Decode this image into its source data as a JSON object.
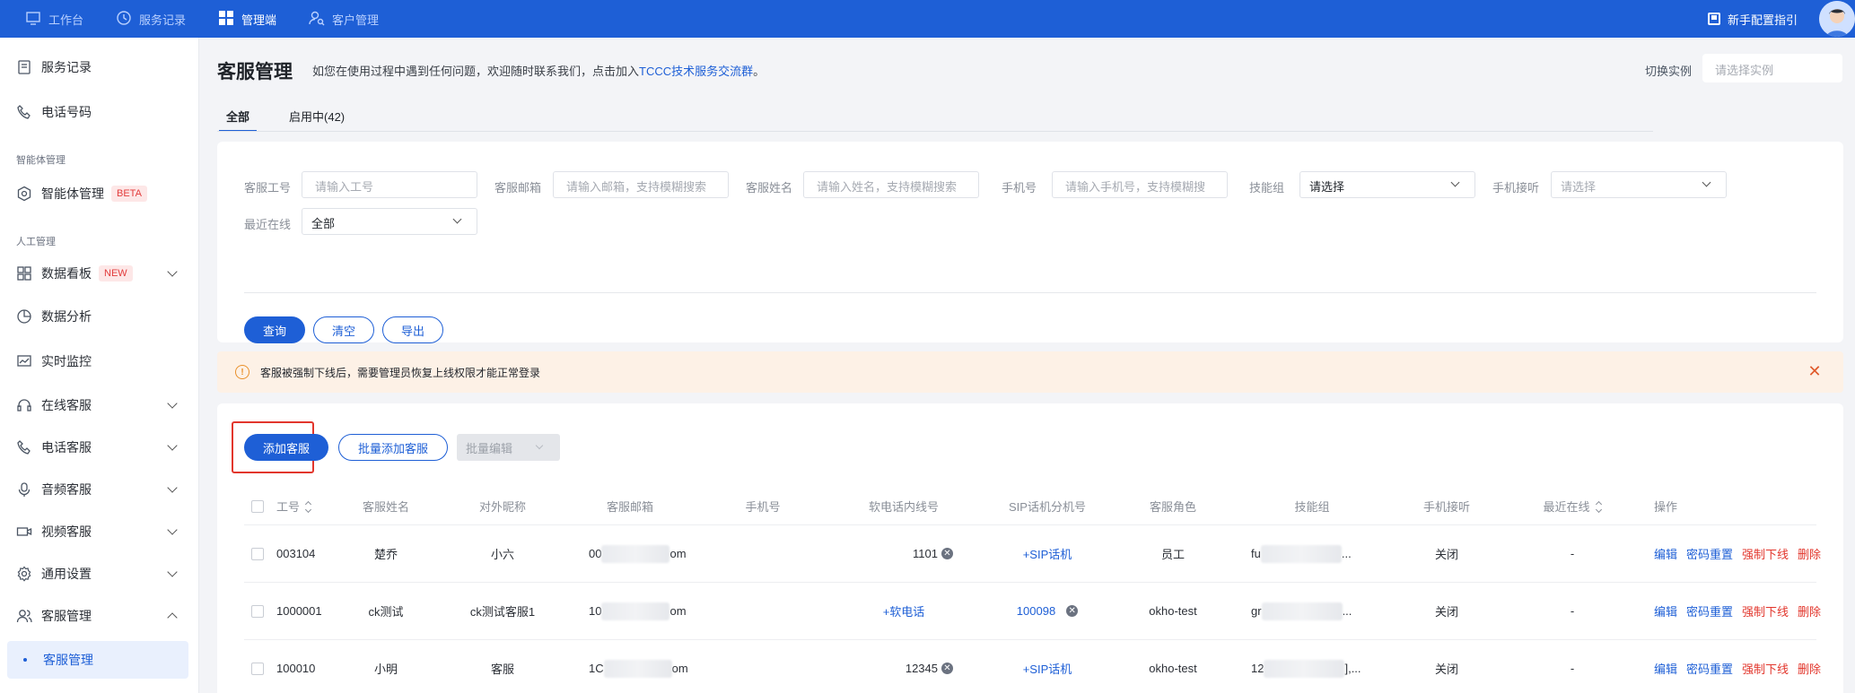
{
  "topbar": {
    "items": [
      {
        "label": "工作台",
        "icon": "monitor-icon"
      },
      {
        "label": "服务记录",
        "icon": "clock-icon"
      },
      {
        "label": "管理端",
        "icon": "grid-icon"
      },
      {
        "label": "客户管理",
        "icon": "user-search-icon"
      }
    ],
    "guide": "新手配置指引"
  },
  "sidebar": {
    "items": {
      "service_records": "服务记录",
      "phone_numbers": "电话号码",
      "group_ai": "智能体管理",
      "ai_manage": "智能体管理",
      "ai_badge": "BETA",
      "group_human": "人工管理",
      "dashboard": "数据看板",
      "dashboard_badge": "NEW",
      "analytics": "数据分析",
      "monitor": "实时监控",
      "online_service": "在线客服",
      "phone_service": "电话客服",
      "audio_service": "音频客服",
      "video_service": "视频客服",
      "general_settings": "通用设置",
      "agent_manage": "客服管理",
      "agent_manage_sub": "客服管理"
    }
  },
  "header": {
    "title": "客服管理",
    "hint_prefix": "如您在使用过程中遇到任何问题，欢迎随时联系我们，点击加入",
    "hint_link": "TCCC技术服务交流群",
    "hint_suffix": "。",
    "instance_label": "切换实例",
    "instance_placeholder": "请选择实例"
  },
  "tabs": [
    {
      "label": "全部"
    },
    {
      "label": "启用中(42)"
    }
  ],
  "filters": {
    "agent_id_label": "客服工号",
    "agent_id_placeholder": "请输入工号",
    "email_label": "客服邮箱",
    "email_placeholder": "请输入邮箱，支持模糊搜索",
    "name_label": "客服姓名",
    "name_placeholder": "请输入姓名，支持模糊搜索",
    "phone_label": "手机号",
    "phone_placeholder": "请输入手机号，支持模糊搜",
    "skill_label": "技能组",
    "skill_value": "请选择",
    "mobile_label": "手机接听",
    "mobile_value": "请选择",
    "recent_label": "最近在线",
    "recent_value": "全部",
    "query": "查询",
    "clear": "清空",
    "export": "导出"
  },
  "notice": {
    "text": "客服被强制下线后，需要管理员恢复上线权限才能正常登录"
  },
  "toolbar": {
    "add": "添加客服",
    "batch_add": "批量添加客服",
    "batch_edit": "批量编辑"
  },
  "table": {
    "columns": [
      "工号",
      "客服姓名",
      "对外昵称",
      "客服邮箱",
      "手机号",
      "软电话内线号",
      "SIP话机分机号",
      "客服角色",
      "技能组",
      "手机接听",
      "最近在线",
      "操作"
    ],
    "rows": [
      {
        "id": "003104",
        "name": "楚乔",
        "nick": "小六",
        "email_start": "00",
        "email_end": "om",
        "phone": "",
        "soft": "1101",
        "sip": "+SIP话机",
        "role": "员工",
        "skill_start": "fu",
        "skill_end": "...",
        "mobile": "关闭",
        "recent": "-"
      },
      {
        "id": "1000001",
        "name": "ck测试",
        "nick": "ck测试客服1",
        "email_start": "10",
        "email_end": "om",
        "phone": "",
        "soft": "+软电话",
        "sip": "100098",
        "role": "okho-test",
        "skill_start": "gr",
        "skill_end": "...",
        "mobile": "关闭",
        "recent": "-"
      },
      {
        "id": "100010",
        "name": "小明",
        "nick": "客服",
        "email_start": "1C",
        "email_end": "om",
        "phone": "",
        "soft": "12345",
        "sip": "+SIP话机",
        "role": "okho-test",
        "skill_start": "12",
        "skill_end": "],...",
        "mobile": "关闭",
        "recent": "-"
      }
    ],
    "actions": {
      "edit": "编辑",
      "reset": "密码重置",
      "force_offline": "强制下线",
      "delete": "删除"
    }
  },
  "colors": {
    "primary": "#1e5fd6",
    "danger": "#e2362c",
    "warning": "#e9902a"
  }
}
